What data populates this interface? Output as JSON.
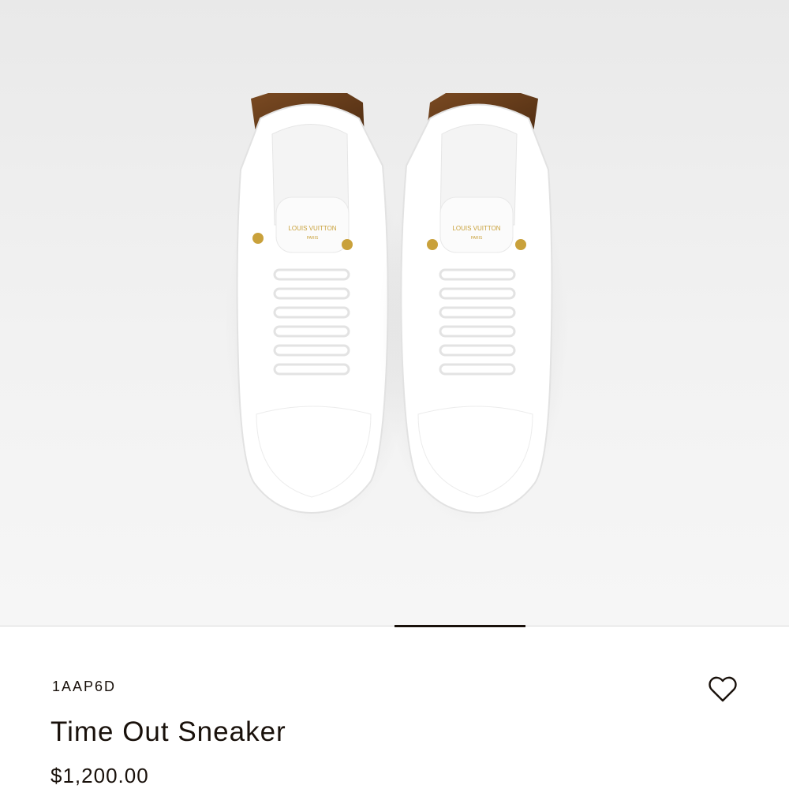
{
  "product": {
    "sku": "1AAP6D",
    "name": "Time Out Sneaker",
    "price": "$1,200.00",
    "image_branding": {
      "logo_text": "LOUIS VUITTON",
      "logo_subtext": "PARIS"
    }
  },
  "carousel": {
    "active_index": 3,
    "total": 6
  },
  "icons": {
    "wishlist": "heart-outline-icon"
  },
  "colors": {
    "text": "#19110b",
    "accent_gold": "#c9a13b",
    "monogram_brown": "#6b3f1e"
  }
}
